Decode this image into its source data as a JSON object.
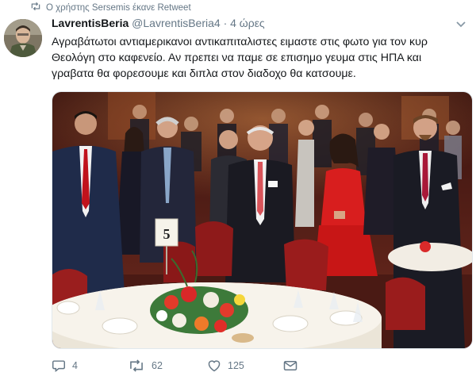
{
  "retweet_notice": "Ο χρήστης Sersemis έκανε Retweet",
  "tweet": {
    "display_name": "LavrentisBeria",
    "handle": "@LavrentisBeria4",
    "separator": "·",
    "time": "4 ώρες",
    "text": "Αγραβάτωτοι αντιαμερικανοι αντικαπιταλιστες ειμαστε στις φωτο για τον κυρ Θεολόγη στο καφενείο. Αν πρεπει να παμε σε  επισημο γευμα στις ΗΠΑ και γραβατα θα φορεσουμε και διπλα στον διαδοχο θα κατσουμε.",
    "photo_sign": "5"
  },
  "actions": {
    "reply_count": "4",
    "retweet_count": "62",
    "like_count": "125"
  },
  "icons": {
    "retweet": "retweet-icon",
    "reply": "reply-icon",
    "like": "heart-icon",
    "message": "envelope-icon",
    "more": "chevron-down-icon"
  },
  "colors": {
    "secondary_text": "#657786",
    "primary_text": "#14171a"
  }
}
